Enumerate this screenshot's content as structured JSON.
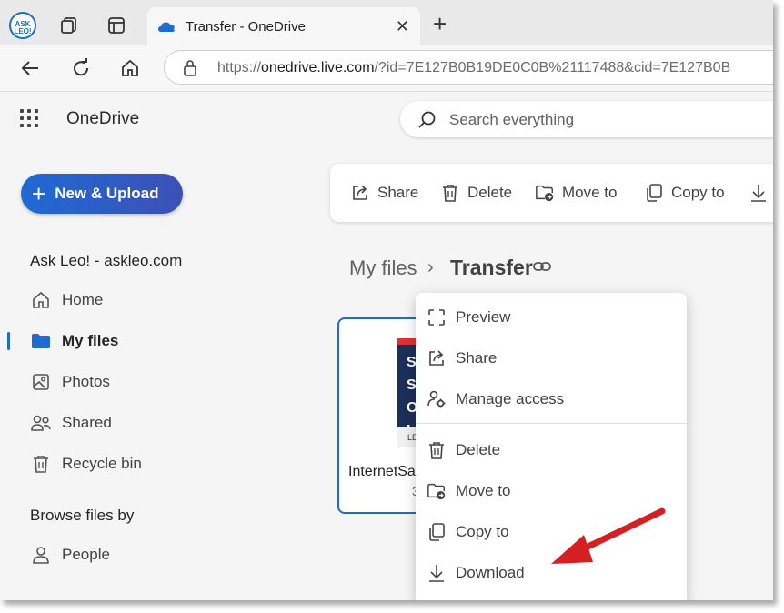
{
  "browser": {
    "tab_title": "Transfer - OneDrive",
    "ext_logo_text": "ASK LEO!",
    "url_prefix": "https://",
    "url_domain": "onedrive.live.com",
    "url_rest": "/?id=7E127B0B19DE0C0B%21117488&cid=7E127B0B"
  },
  "header": {
    "app_name": "OneDrive",
    "search_placeholder": "Search everything"
  },
  "sidebar": {
    "new_button_label": "New & Upload",
    "account": "Ask Leo! - askleo.com",
    "items": [
      {
        "label": "Home",
        "icon": "home-icon"
      },
      {
        "label": "My files",
        "icon": "folder-icon",
        "active": true
      },
      {
        "label": "Photos",
        "icon": "image-icon"
      },
      {
        "label": "Shared",
        "icon": "people-icon"
      },
      {
        "label": "Recycle bin",
        "icon": "trash-icon"
      }
    ],
    "browse_heading": "Browse files by",
    "browse_items": [
      {
        "label": "People",
        "icon": "person-icon"
      }
    ]
  },
  "commandbar": {
    "share": "Share",
    "delete": "Delete",
    "move_to": "Move to",
    "copy_to": "Copy to"
  },
  "breadcrumb": {
    "root": "My files",
    "current": "Transfer"
  },
  "file": {
    "name": "InternetSa",
    "sub": "3",
    "thumb_text": "S S O I",
    "thumb_footer": "LE"
  },
  "context_menu": {
    "items": [
      {
        "label": "Preview",
        "icon": "preview-icon"
      },
      {
        "label": "Share",
        "icon": "share-icon"
      },
      {
        "label": "Manage access",
        "icon": "manage-access-icon"
      },
      {
        "label": "Delete",
        "icon": "trash-icon"
      },
      {
        "label": "Move to",
        "icon": "move-to-icon"
      },
      {
        "label": "Copy to",
        "icon": "copy-icon"
      },
      {
        "label": "Download",
        "icon": "download-icon"
      }
    ]
  },
  "colors": {
    "accent": "#1f6ad3",
    "annotation_arrow": "#d42020"
  }
}
